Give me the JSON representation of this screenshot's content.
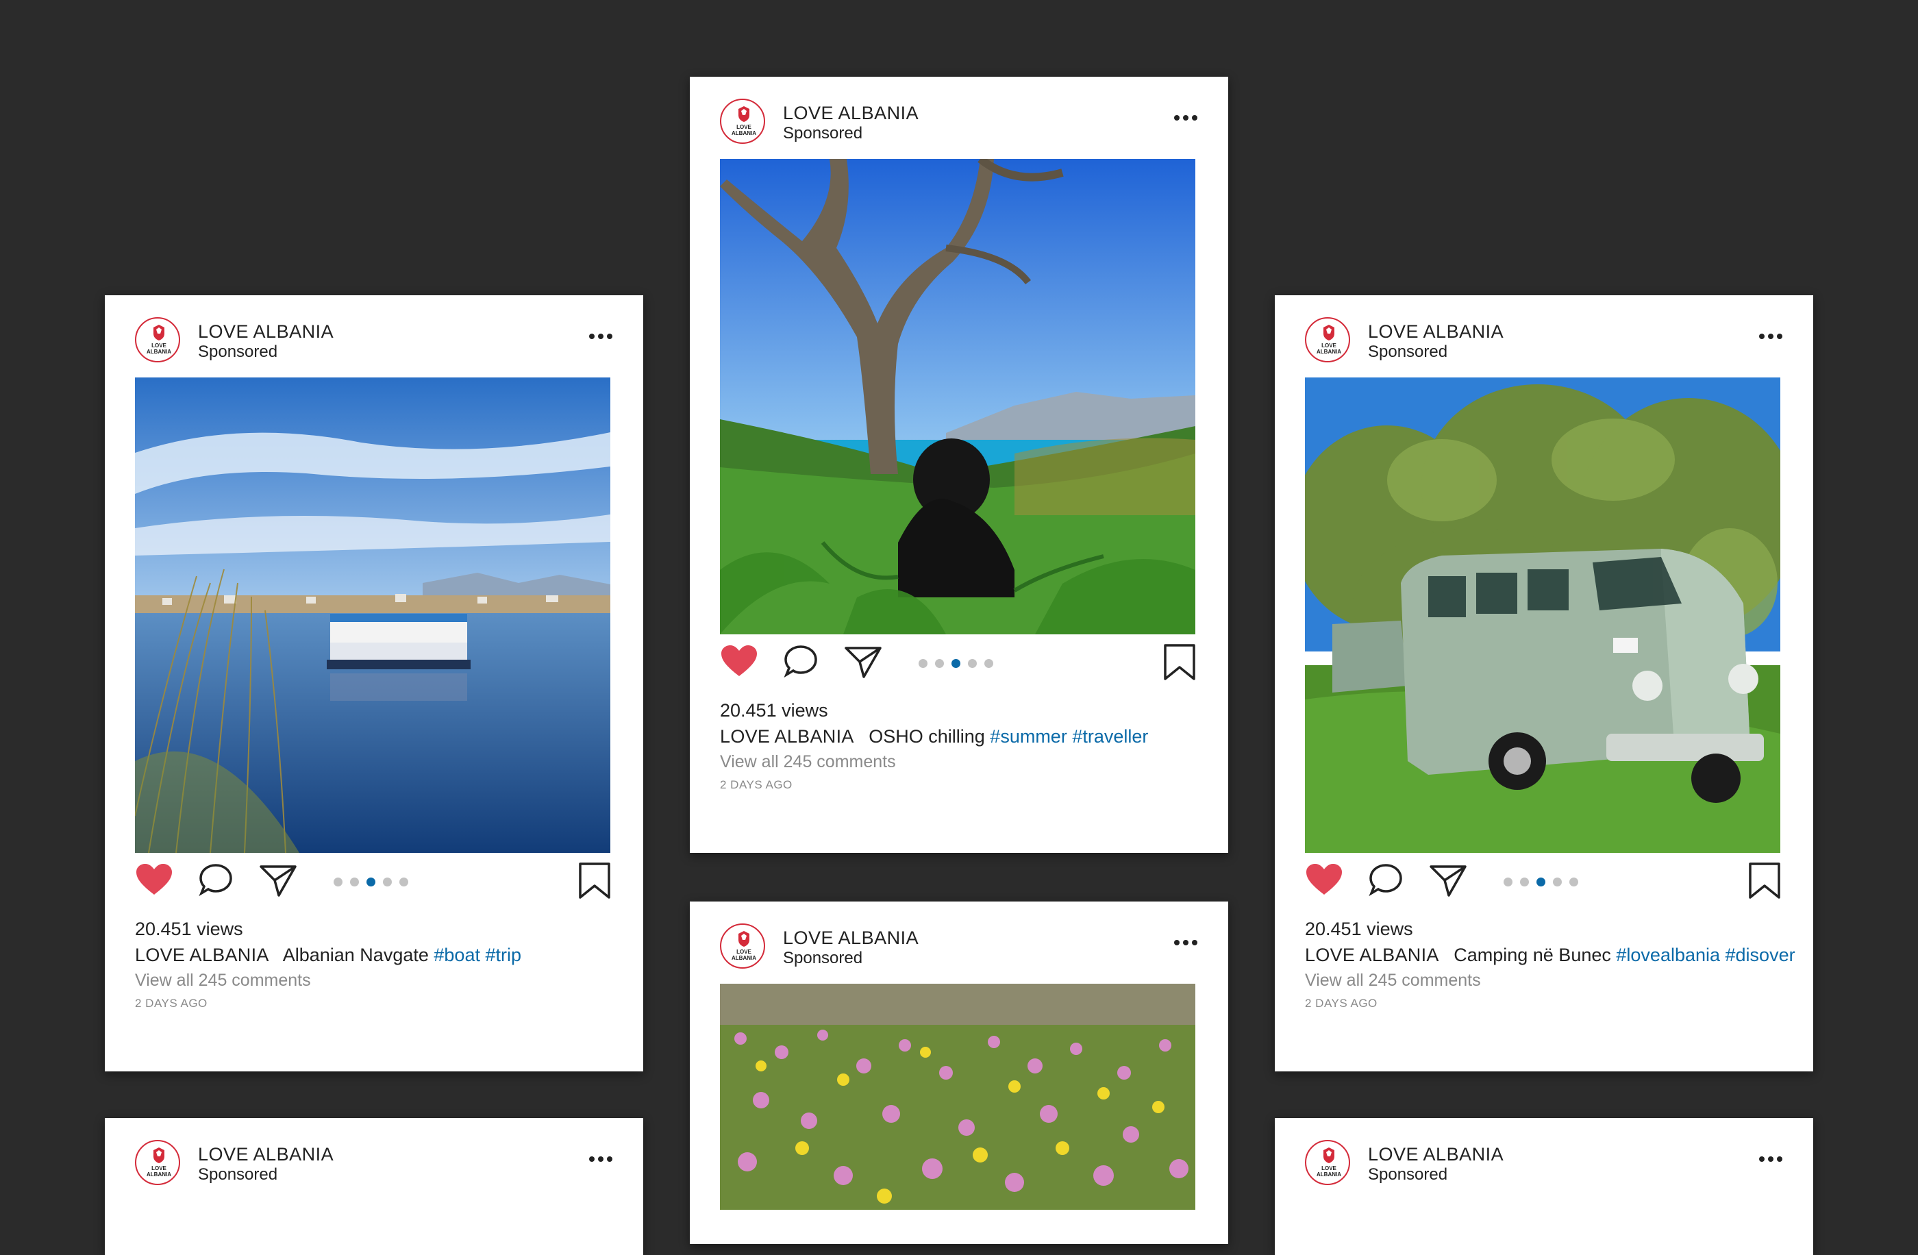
{
  "brand": "LOVE ALBANIA",
  "sponsored": "Sponsored",
  "logo_text": [
    "LOVE",
    "ALBANIA"
  ],
  "colors": {
    "background": "#2b2b2b",
    "heart": "#e24556",
    "hashtag": "#0b6aa8",
    "dot_active": "#0b6aa8"
  },
  "posts": [
    {
      "views": "20.451 views",
      "caption": "Albanian Navgate",
      "tags": "#boat #trip",
      "comments": "View all 245 comments",
      "ago": "2 DAYS AGO",
      "photo": "lake-boat",
      "carousel_active": 3,
      "carousel_total": 5
    },
    {
      "views": "20.451 views",
      "caption": "OSHO chilling",
      "tags": "#summer #traveller",
      "comments": "View all 245 comments",
      "ago": "2 DAYS AGO",
      "photo": "dog-olive-tree",
      "carousel_active": 3,
      "carousel_total": 5
    },
    {
      "views": "20.451 views",
      "caption": "Camping në Bunec",
      "tags": "#lovealbania #disover",
      "comments": "View all 245 comments",
      "ago": "2 DAYS AGO",
      "photo": "green-van-camping",
      "carousel_active": 3,
      "carousel_total": 5
    },
    {
      "photo": "flower-field"
    },
    {
      "photo": "none"
    },
    {
      "photo": "none"
    }
  ],
  "icons": [
    "logo-icon",
    "more-icon",
    "heart-icon",
    "comment-icon",
    "share-icon",
    "bookmark-icon"
  ]
}
